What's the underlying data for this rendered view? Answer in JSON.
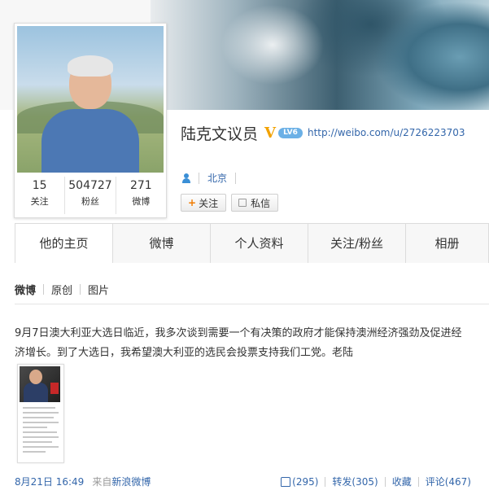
{
  "profile": {
    "name": "陆克文议员",
    "verified_badge": "V",
    "level_badge": "LV6",
    "url": "http://weibo.com/u/2726223703",
    "location": "北京",
    "stats": [
      {
        "value": "15",
        "label": "关注"
      },
      {
        "value": "504727",
        "label": "粉丝"
      },
      {
        "value": "271",
        "label": "微博"
      }
    ],
    "buttons": {
      "follow_plus": "+",
      "follow": "关注",
      "message": "私信"
    }
  },
  "tabs": [
    "他的主页",
    "微博",
    "个人资料",
    "关注/粉丝",
    "相册"
  ],
  "subtabs": [
    "微博",
    "原创",
    "图片"
  ],
  "post": {
    "text": "9月7日澳大利亚大选日临近，我多次谈到需要一个有决策的政府才能保持澳洲经济强劲及促进经济增长。到了大选日，我希望澳大利亚的选民会投票支持我们工党。老陆",
    "date": "8月21日 16:49",
    "from_label": "来自",
    "client": "新浪微博",
    "likes": "(295)",
    "repost": "转发(305)",
    "favorite": "收藏",
    "comment": "评论(467)"
  },
  "colors": {
    "link": "#3366aa",
    "accent_orange": "#f07b00",
    "verified_gold": "#f2a200"
  },
  "icons": {
    "location": "user-icon",
    "message": "message-icon",
    "like": "thumbs-up-icon"
  }
}
